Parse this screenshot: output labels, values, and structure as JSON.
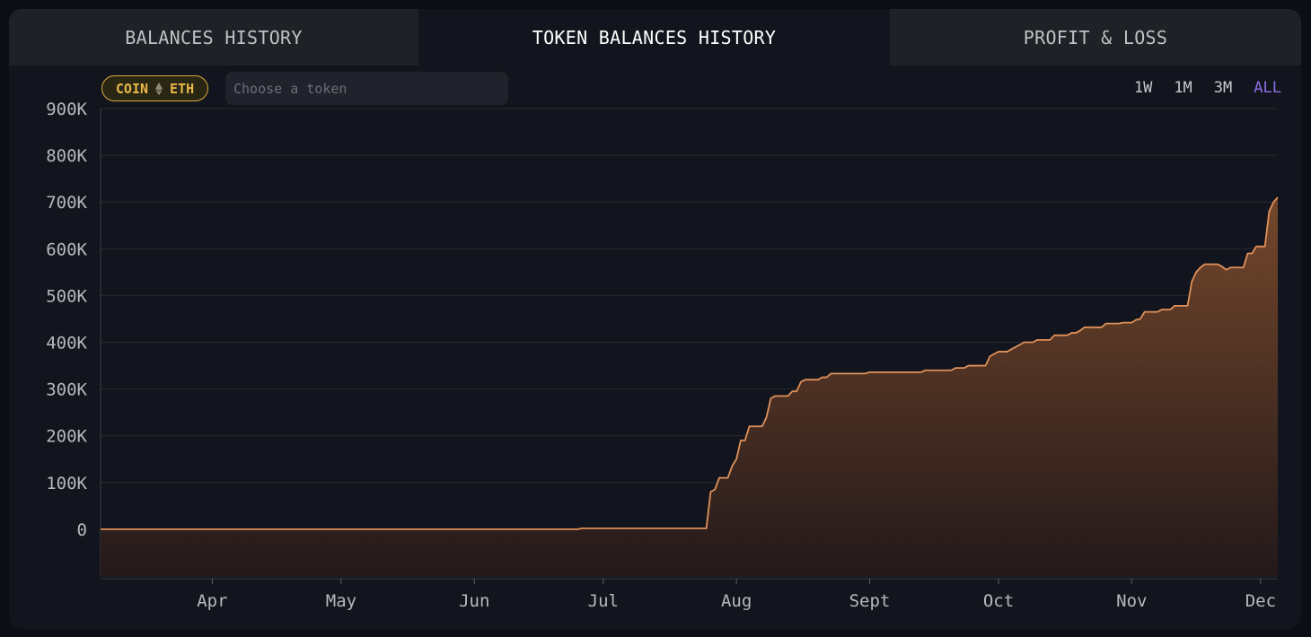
{
  "tabs": [
    {
      "label": "BALANCES HISTORY",
      "active": false
    },
    {
      "label": "TOKEN BALANCES HISTORY",
      "active": true
    },
    {
      "label": "PROFIT & LOSS",
      "active": false
    }
  ],
  "badge": {
    "left": "COIN",
    "right": "ETH",
    "icon": "eth-icon",
    "color": "#e8b84a"
  },
  "search": {
    "placeholder": "Choose a token",
    "value": ""
  },
  "ranges": [
    {
      "label": "1W",
      "active": false
    },
    {
      "label": "1M",
      "active": false
    },
    {
      "label": "3M",
      "active": false
    },
    {
      "label": "ALL",
      "active": true
    }
  ],
  "colors": {
    "accent": "#8a6fe8",
    "line": "#e0915a",
    "fill_top": "#7a4a2c",
    "fill_bottom": "#24191a"
  },
  "chart_data": {
    "type": "area",
    "title": "",
    "xlabel": "",
    "ylabel": "",
    "ylim": [
      -100000,
      900000
    ],
    "y_ticks": [
      0,
      100000,
      200000,
      300000,
      400000,
      500000,
      600000,
      700000,
      800000,
      900000
    ],
    "y_tick_labels": [
      "0",
      "100K",
      "200K",
      "300K",
      "400K",
      "500K",
      "600K",
      "700K",
      "800K",
      "900K"
    ],
    "x_tick_labels": [
      "Apr",
      "May",
      "Jun",
      "Jul",
      "Aug",
      "Sept",
      "Oct",
      "Nov",
      "Dec"
    ],
    "x_tick_dates": [
      "2024-04-01",
      "2024-05-01",
      "2024-06-01",
      "2024-07-01",
      "2024-08-01",
      "2024-09-01",
      "2024-10-01",
      "2024-11-01",
      "2024-12-01"
    ],
    "xlim": [
      "2024-03-06",
      "2024-12-05"
    ],
    "grid": true,
    "series": [
      {
        "points": [
          [
            "2024-03-06",
            0
          ],
          [
            "2024-06-25",
            0
          ],
          [
            "2024-06-26",
            2000
          ],
          [
            "2024-07-25",
            2000
          ],
          [
            "2024-07-26",
            80000
          ],
          [
            "2024-07-27",
            85000
          ],
          [
            "2024-07-28",
            110000
          ],
          [
            "2024-07-30",
            110000
          ],
          [
            "2024-07-31",
            135000
          ],
          [
            "2024-08-01",
            150000
          ],
          [
            "2024-08-02",
            190000
          ],
          [
            "2024-08-03",
            190000
          ],
          [
            "2024-08-04",
            220000
          ],
          [
            "2024-08-07",
            220000
          ],
          [
            "2024-08-08",
            240000
          ],
          [
            "2024-08-09",
            280000
          ],
          [
            "2024-08-10",
            285000
          ],
          [
            "2024-08-13",
            285000
          ],
          [
            "2024-08-14",
            295000
          ],
          [
            "2024-08-15",
            295000
          ],
          [
            "2024-08-16",
            315000
          ],
          [
            "2024-08-17",
            320000
          ],
          [
            "2024-08-20",
            320000
          ],
          [
            "2024-08-21",
            325000
          ],
          [
            "2024-08-22",
            325000
          ],
          [
            "2024-08-23",
            333000
          ],
          [
            "2024-08-31",
            333000
          ],
          [
            "2024-09-01",
            336000
          ],
          [
            "2024-09-13",
            336000
          ],
          [
            "2024-09-14",
            340000
          ],
          [
            "2024-09-20",
            340000
          ],
          [
            "2024-09-21",
            345000
          ],
          [
            "2024-09-23",
            345000
          ],
          [
            "2024-09-24",
            350000
          ],
          [
            "2024-09-28",
            350000
          ],
          [
            "2024-09-29",
            370000
          ],
          [
            "2024-09-30",
            375000
          ],
          [
            "2024-10-01",
            380000
          ],
          [
            "2024-10-03",
            380000
          ],
          [
            "2024-10-04",
            385000
          ],
          [
            "2024-10-05",
            390000
          ],
          [
            "2024-10-06",
            395000
          ],
          [
            "2024-10-07",
            400000
          ],
          [
            "2024-10-09",
            400000
          ],
          [
            "2024-10-10",
            405000
          ],
          [
            "2024-10-13",
            405000
          ],
          [
            "2024-10-14",
            415000
          ],
          [
            "2024-10-17",
            415000
          ],
          [
            "2024-10-18",
            420000
          ],
          [
            "2024-10-19",
            420000
          ],
          [
            "2024-10-20",
            425000
          ],
          [
            "2024-10-21",
            432000
          ],
          [
            "2024-10-25",
            432000
          ],
          [
            "2024-10-26",
            440000
          ],
          [
            "2024-10-29",
            440000
          ],
          [
            "2024-10-30",
            442000
          ],
          [
            "2024-11-01",
            442000
          ],
          [
            "2024-11-02",
            448000
          ],
          [
            "2024-11-03",
            450000
          ],
          [
            "2024-11-04",
            465000
          ],
          [
            "2024-11-07",
            465000
          ],
          [
            "2024-11-08",
            470000
          ],
          [
            "2024-11-10",
            470000
          ],
          [
            "2024-11-11",
            478000
          ],
          [
            "2024-11-14",
            478000
          ],
          [
            "2024-11-15",
            530000
          ],
          [
            "2024-11-16",
            550000
          ],
          [
            "2024-11-17",
            560000
          ],
          [
            "2024-11-18",
            567000
          ],
          [
            "2024-11-21",
            567000
          ],
          [
            "2024-11-22",
            562000
          ],
          [
            "2024-11-23",
            555000
          ],
          [
            "2024-11-24",
            560000
          ],
          [
            "2024-11-27",
            560000
          ],
          [
            "2024-11-28",
            590000
          ],
          [
            "2024-11-29",
            590000
          ],
          [
            "2024-11-30",
            605000
          ],
          [
            "2024-12-02",
            605000
          ],
          [
            "2024-12-03",
            680000
          ],
          [
            "2024-12-04",
            700000
          ],
          [
            "2024-12-05",
            710000
          ]
        ]
      }
    ]
  }
}
